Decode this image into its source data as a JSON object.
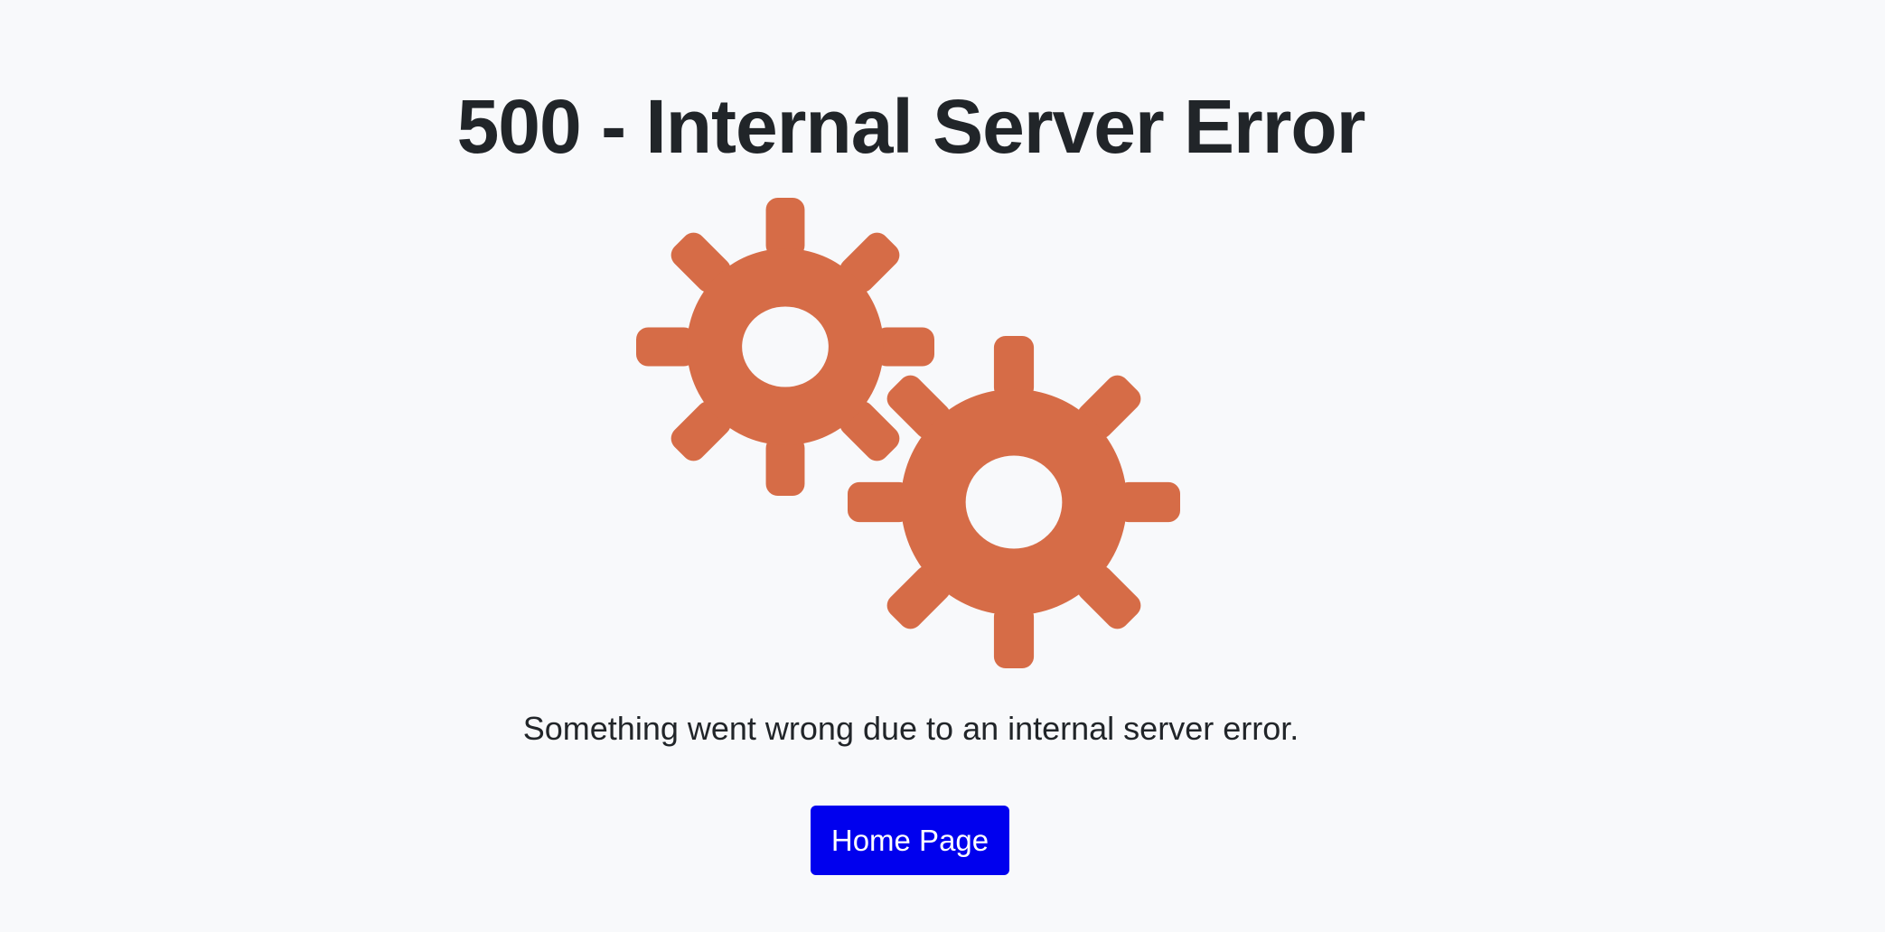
{
  "error": {
    "title": "500 - Internal Server Error",
    "message": "Something went wrong due to an internal server error.",
    "illustration": "gears-icon",
    "accent_color": "#d66c47"
  },
  "actions": {
    "home_label": "Home Page",
    "button_color": "#0000ee"
  }
}
